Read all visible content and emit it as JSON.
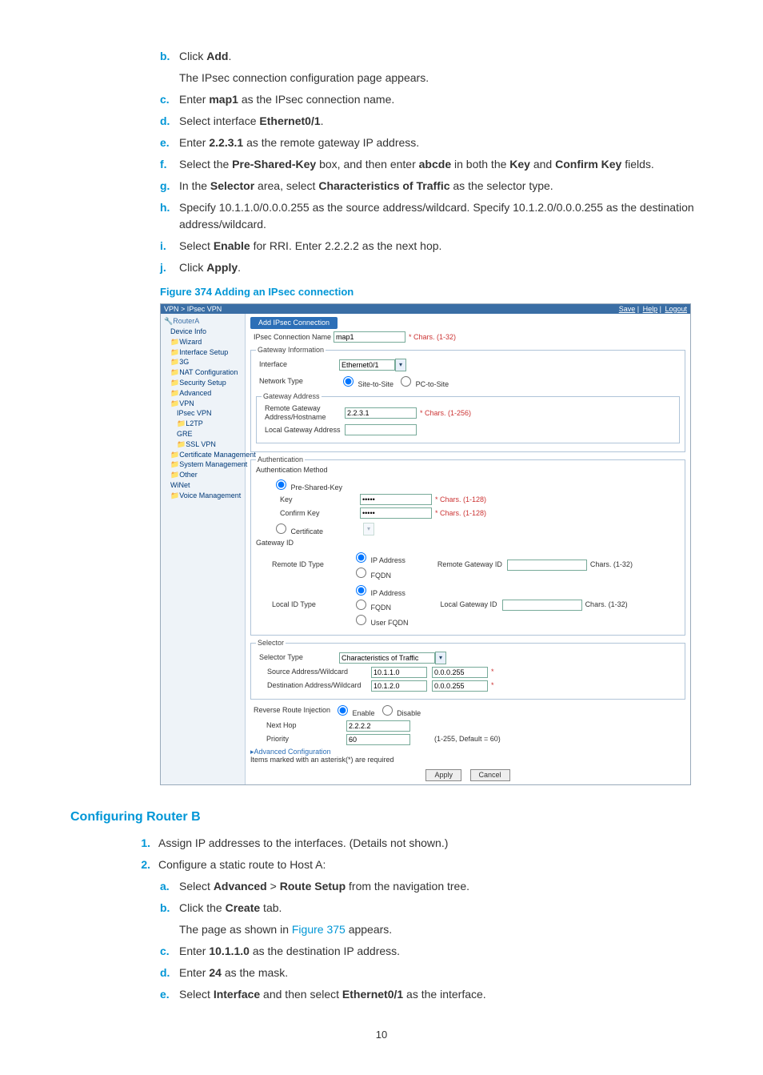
{
  "steps1": {
    "b": {
      "pre": "Click ",
      "bold": "Add",
      "post": ".",
      "note": "The IPsec connection configuration page appears."
    },
    "c": {
      "pre": "Enter ",
      "bold": "map1",
      "post": " as the IPsec connection name."
    },
    "d": {
      "pre": "Select interface ",
      "bold": "Ethernet0/1",
      "post": "."
    },
    "e": {
      "pre": "Enter ",
      "bold": "2.2.3.1",
      "post": " as the remote gateway IP address."
    },
    "f": {
      "t1": "Select the ",
      "b1": "Pre-Shared-Key",
      "t2": " box, and then enter ",
      "b2": "abcde",
      "t3": " in both the ",
      "b3": "Key",
      "t4": " and ",
      "b4": "Confirm Key",
      "t5": " fields."
    },
    "g": {
      "t1": "In the ",
      "b1": "Selector",
      "t2": " area, select ",
      "b2": "Characteristics of Traffic",
      "t3": " as the selector type."
    },
    "h": "Specify 10.1.1.0/0.0.0.255 as the source address/wildcard. Specify 10.1.2.0/0.0.0.255 as the destination address/wildcard.",
    "i": {
      "t1": "Select ",
      "b1": "Enable",
      "t2": " for RRI. Enter 2.2.2.2 as the next hop."
    },
    "j": {
      "t1": "Click ",
      "b1": "Apply",
      "t2": "."
    }
  },
  "figcap": "Figure 374 Adding an IPsec connection",
  "shot": {
    "breadcrumb": "VPN > IPsec VPN",
    "toplinks": [
      "Save",
      "Help",
      "Logout"
    ],
    "root": "RouterA",
    "nav": [
      "Device Info",
      "Wizard",
      "Interface Setup",
      "3G",
      "NAT Configuration",
      "Security Setup",
      "Advanced",
      "VPN",
      "IPsec VPN",
      "L2TP",
      "GRE",
      "SSL VPN",
      "Certificate Management",
      "System Management",
      "Other",
      "WiNet",
      "Voice Management"
    ],
    "tab": "Add IPsec Connection",
    "connNameLbl": "IPsec Connection Name",
    "connName": "map1",
    "connNameHint": "* Chars. (1-32)",
    "fs_gw": "Gateway Information",
    "ifaceLbl": "Interface",
    "iface": "Ethernet0/1",
    "netTypeLbl": "Network Type",
    "netType1": "Site-to-Site",
    "netType2": "PC-to-Site",
    "fs_gwaddr": "Gateway Address",
    "remGwLbl": "Remote Gateway Address/Hostname",
    "remGw": "2.2.3.1",
    "remGwHint": "* Chars. (1-256)",
    "locGwLbl": "Local Gateway Address",
    "fs_auth": "Authentication",
    "authMethodLbl": "Authentication Method",
    "psk": "Pre-Shared-Key",
    "keyLbl": "Key",
    "keyHint": "* Chars. (1-128)",
    "ckeyLbl": "Confirm Key",
    "ckeyHint": "* Chars. (1-128)",
    "cert": "Certificate",
    "gwIdLbl": "Gateway ID",
    "remIdTypeLbl": "Remote ID Type",
    "ip": "IP Address",
    "fqdn": "FQDN",
    "ufqdn": "User FQDN",
    "remGwIdLbl": "Remote Gateway ID",
    "remGwIdHint": "Chars. (1-32)",
    "locIdTypeLbl": "Local ID Type",
    "locGwIdLbl": "Local Gateway ID",
    "locGwIdHint": "Chars. (1-32)",
    "fs_sel": "Selector",
    "selTypeLbl": "Selector Type",
    "selType": "Characteristics of Traffic",
    "srcLbl": "Source Address/Wildcard",
    "src1": "10.1.1.0",
    "src2": "0.0.0.255",
    "dstLbl": "Destination Address/Wildcard",
    "dst1": "10.1.2.0",
    "dst2": "0.0.0.255",
    "rriLbl": "Reverse Route Injection",
    "enable": "Enable",
    "disable": "Disable",
    "nextHopLbl": "Next Hop",
    "nextHop": "2.2.2.2",
    "prioLbl": "Priority",
    "prio": "60",
    "prioHint": "(1-255, Default = 60)",
    "advcfg": "Advanced Configuration",
    "reqnote": "Items marked with an asterisk(*) are required",
    "apply": "Apply",
    "cancel": "Cancel"
  },
  "heading2": "Configuring Router B",
  "num1": "Assign IP addresses to the interfaces. (Details not shown.)",
  "num2": "Configure a static route to Host A:",
  "sub": {
    "a": {
      "t1": "Select ",
      "b1": "Advanced",
      "t2": " > ",
      "b2": "Route Setup",
      "t3": " from the navigation tree."
    },
    "b": {
      "t1": "Click the ",
      "b1": "Create",
      "t2": " tab.",
      "note1": "The page as shown in ",
      "link": "Figure 375",
      "note2": " appears."
    },
    "c": {
      "t1": "Enter ",
      "b1": "10.1.1.0",
      "t2": " as the destination IP address."
    },
    "d": {
      "t1": "Enter ",
      "b1": "24",
      "t2": " as the mask."
    },
    "e": {
      "t1": "Select ",
      "b1": "Interface",
      "t2": " and then select ",
      "b2": "Ethernet0/1",
      "t3": " as the interface."
    }
  },
  "pagenum": "10"
}
